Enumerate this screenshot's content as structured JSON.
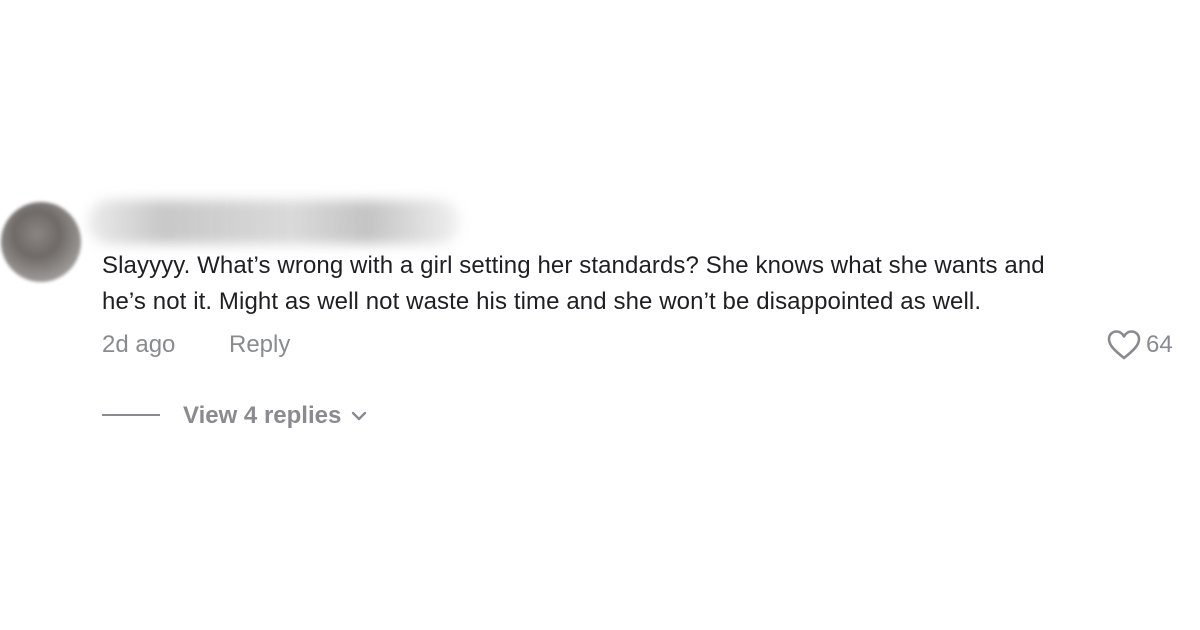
{
  "comment": {
    "text_line1": "Slayyyy. What’s wrong with a girl setting her standards? She knows what she wants and",
    "text_line2": "he’s not it. Might as well not waste his time and she won’t be disappointed as well.",
    "time": "2d ago",
    "reply_label": "Reply",
    "like_count": "64",
    "icons": {
      "like": "heart-outline-icon",
      "expand": "chevron-down-icon"
    }
  },
  "replies": {
    "label": "View 4 replies"
  },
  "colors": {
    "text": "#1f1f23",
    "muted": "#8a8b91",
    "background": "#ffffff"
  }
}
